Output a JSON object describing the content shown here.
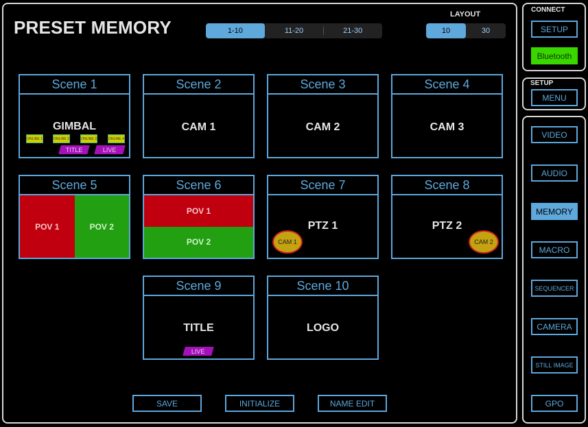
{
  "header": {
    "title": "PRESET MEMORY",
    "page_tabs": [
      {
        "label": "1-10",
        "active": true
      },
      {
        "label": "11-20",
        "active": false
      },
      {
        "label": "21-30",
        "active": false
      }
    ],
    "layout_label": "LAYOUT",
    "layout_tabs": [
      {
        "label": "10",
        "active": true
      },
      {
        "label": "30",
        "active": false
      }
    ]
  },
  "scenes": [
    {
      "title": "Scene 1",
      "label": "GIMBAL",
      "online": [
        "ONLINE 1",
        "ONLINE 2",
        "ONLINE 3",
        "ONLINE 4"
      ],
      "tags": [
        "TITLE",
        "LIVE"
      ]
    },
    {
      "title": "Scene 2",
      "label": "CAM 1"
    },
    {
      "title": "Scene 3",
      "label": "CAM 2"
    },
    {
      "title": "Scene 4",
      "label": "CAM 3"
    },
    {
      "title": "Scene 5",
      "left": "POV 1",
      "right": "POV 2"
    },
    {
      "title": "Scene 6",
      "top": "POV 1",
      "bottom": "POV 2"
    },
    {
      "title": "Scene 7",
      "label": "PTZ 1",
      "cam": "CAM 1"
    },
    {
      "title": "Scene 8",
      "label": "PTZ 2",
      "cam": "CAM 2"
    },
    {
      "title": "Scene 9",
      "label": "TITLE",
      "tag": "LIVE"
    },
    {
      "title": "Scene 10",
      "label": "LOGO"
    }
  ],
  "footer": {
    "save": "SAVE",
    "initialize": "INITIALIZE",
    "name_edit": "NAME EDIT"
  },
  "sidebar": {
    "connect_label": "CONNECT",
    "setup_button": "SETUP",
    "bluetooth_button": "Bluetooth",
    "setup_label": "SETUP",
    "menu_button": "MENU",
    "nav": [
      "VIDEO",
      "AUDIO",
      "MEMORY",
      "MACRO",
      "SEQUENCER",
      "CAMERA",
      "STILL IMAGE",
      "GPO"
    ],
    "active_nav": "MEMORY"
  },
  "colors": {
    "accent": "#5ea8dc",
    "red": "#c0000f",
    "green": "#22a012",
    "magenta": "#a411b8",
    "bluetooth": "#3ad600"
  }
}
